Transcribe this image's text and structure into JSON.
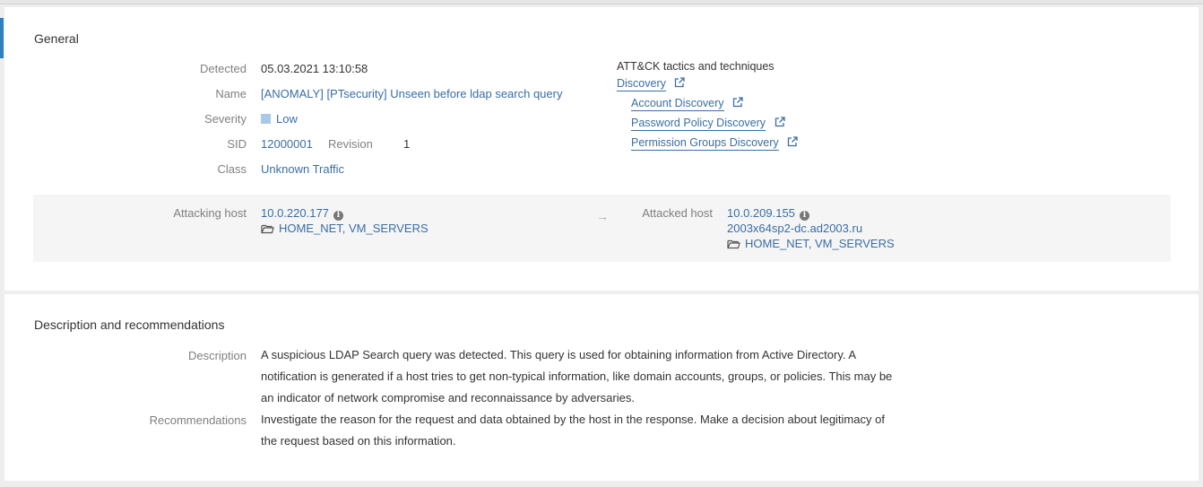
{
  "general": {
    "title": "General",
    "detected_label": "Detected",
    "detected_value": "05.03.2021 13:10:58",
    "name_label": "Name",
    "name_value": "[ANOMALY] [PTsecurity] Unseen before ldap search query",
    "severity_label": "Severity",
    "severity_value": "Low",
    "severity_color": "#a9c9ea",
    "sid_label": "SID",
    "sid_value": "12000001",
    "revision_label": "Revision",
    "revision_value": "1",
    "class_label": "Class",
    "class_value": "Unknown Traffic",
    "attack": {
      "title": "ATT&CK tactics and techniques",
      "tactic": "Discovery",
      "techniques": [
        "Account Discovery",
        "Password Policy Discovery",
        "Permission Groups Discovery"
      ]
    },
    "attacking": {
      "label": "Attacking host",
      "ip": "10.0.220.177",
      "groups": "HOME_NET, VM_SERVERS"
    },
    "arrow": "→",
    "attacked": {
      "label": "Attacked host",
      "ip": "10.0.209.155",
      "hostname": "2003x64sp2-dc.ad2003.ru",
      "groups": "HOME_NET, VM_SERVERS"
    }
  },
  "description": {
    "title": "Description and recommendations",
    "description_label": "Description",
    "description_text": "A suspicious LDAP Search query was detected. This query is used for obtaining information from Active Directory. A notification is generated if a host tries to get non-typical information, like domain accounts, groups, or policies. This may be an indicator of network compromise and reconnaissance by adversaries.",
    "recommendations_label": "Recommendations",
    "recommendations_text": "Investigate the reason for the request and data obtained by the host in the response. Make a decision about legitimacy of the request based on this information."
  },
  "colors": {
    "accent": "#2f7fc1",
    "link": "#3a6ea5"
  }
}
